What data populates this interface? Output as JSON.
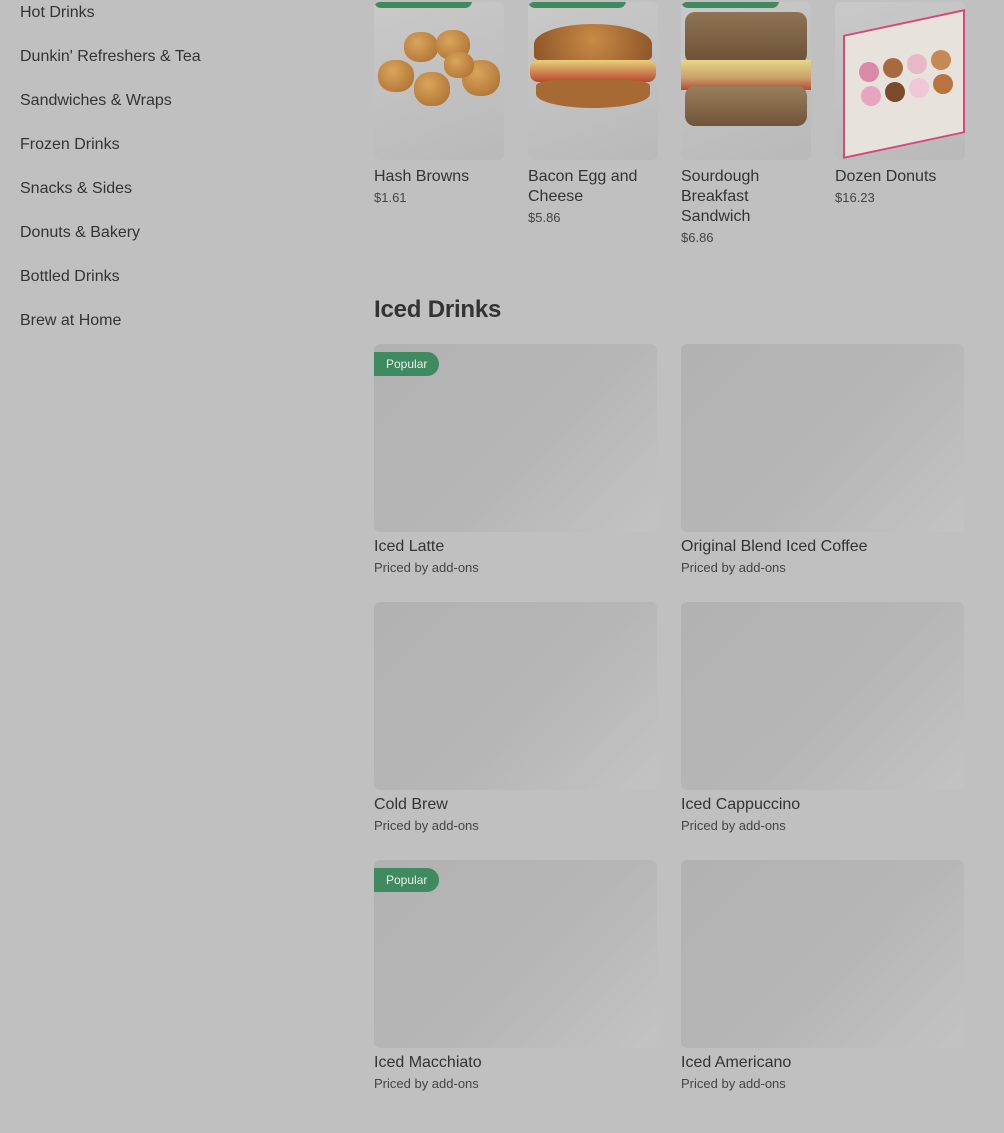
{
  "sidebar": {
    "categories": [
      "Hot Drinks",
      "Dunkin' Refreshers & Tea",
      "Sandwiches & Wraps",
      "Frozen Drinks",
      "Snacks & Sides",
      "Donuts & Bakery",
      "Bottled Drinks",
      "Brew at Home"
    ]
  },
  "top_row": [
    {
      "name": "Hash Browns",
      "price": "$1.61",
      "image_icon": "hash-browns-image"
    },
    {
      "name": "Bacon Egg and Cheese",
      "price": "$5.86",
      "image_icon": "bagel-sandwich-image"
    },
    {
      "name": "Sourdough Breakfast Sandwich",
      "price": "$6.86",
      "image_icon": "sourdough-sandwich-image"
    },
    {
      "name": "Dozen Donuts",
      "price": "$16.23",
      "image_icon": "donut-box-image"
    }
  ],
  "iced_drinks": {
    "title": "Iced Drinks",
    "items": [
      {
        "name": "Iced Latte",
        "price": "Priced by add-ons",
        "badge": "Popular"
      },
      {
        "name": "Original Blend Iced Coffee",
        "price": "Priced by add-ons",
        "badge": ""
      },
      {
        "name": "Cold Brew",
        "price": "Priced by add-ons",
        "badge": ""
      },
      {
        "name": "Iced Cappuccino",
        "price": "Priced by add-ons",
        "badge": ""
      },
      {
        "name": "Iced Macchiato",
        "price": "Priced by add-ons",
        "badge": "Popular"
      },
      {
        "name": "Iced Americano",
        "price": "Priced by add-ons",
        "badge": ""
      }
    ]
  },
  "colors": {
    "overlay_background": "#c0c0c0",
    "badge_green": "#3f8a5f",
    "text": "#333333"
  }
}
